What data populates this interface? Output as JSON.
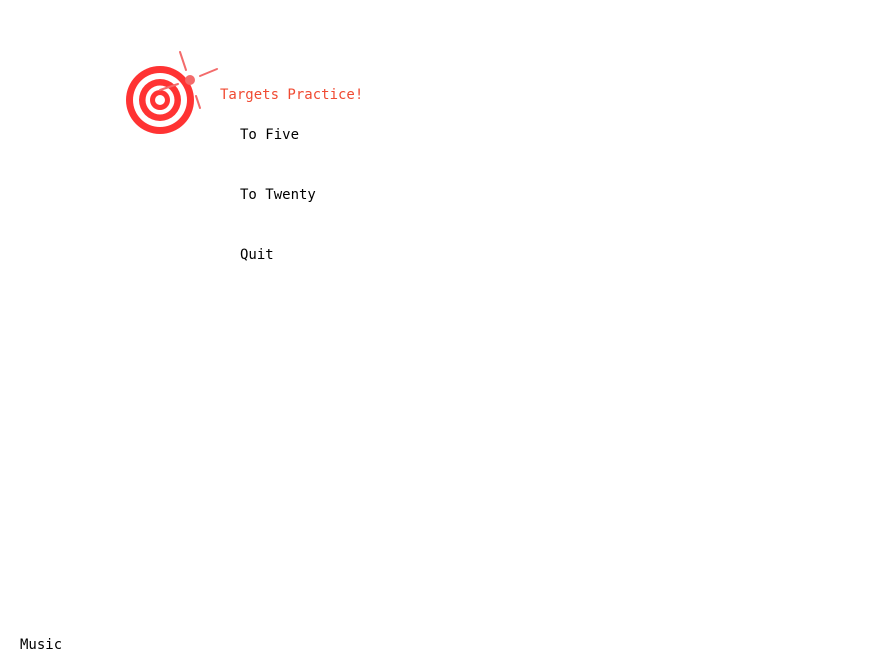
{
  "colors": {
    "accent": "#ff3333",
    "title": "#f04a32",
    "text": "#000000",
    "background": "#ffffff",
    "sparkle": "#f36b6b"
  },
  "logo": {
    "icon": "target-icon"
  },
  "title": "Targets Practice!",
  "menu": {
    "items": [
      {
        "id": "to-five",
        "label": "To Five"
      },
      {
        "id": "to-twenty",
        "label": "To Twenty"
      },
      {
        "id": "quit",
        "label": "Quit"
      }
    ]
  },
  "footer": {
    "music_label": "Music"
  }
}
